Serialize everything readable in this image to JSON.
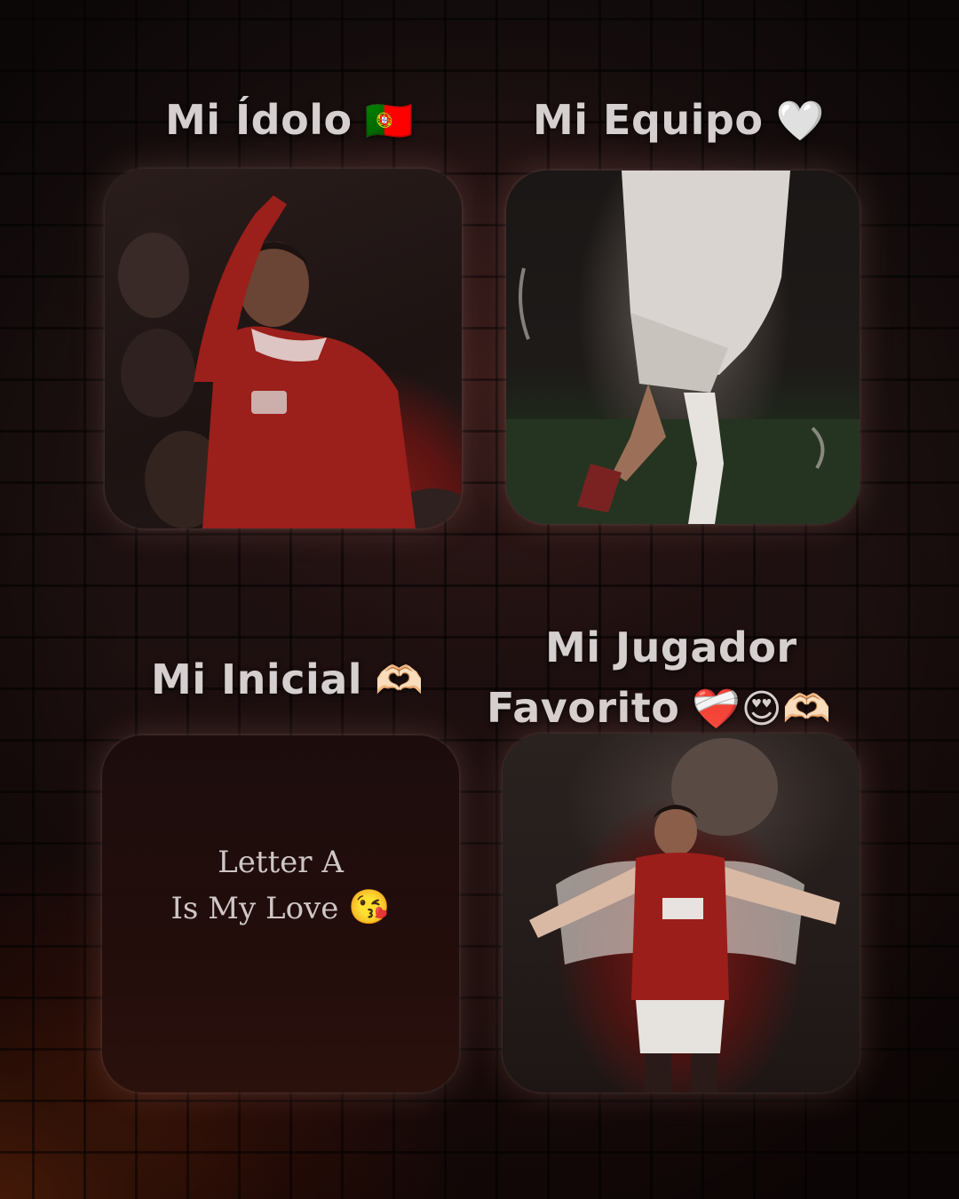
{
  "colors": {
    "background": "#140808",
    "glow": "#be4614",
    "label_text": "#d6cfcf"
  },
  "cards": {
    "idolo": {
      "title": "Mi Ídolo",
      "emoji": "🇵🇹",
      "image": "player-red-kit"
    },
    "equipo": {
      "title": "Mi Equipo",
      "emoji": "🤍",
      "image": "player-white-kit"
    },
    "inicial": {
      "title": "Mi Inicial",
      "emoji": "🫶🏻",
      "line1": "Letter A",
      "line2": "Is My Love",
      "line2_emoji": "😘"
    },
    "favorito": {
      "title_line1": "Mi Jugador",
      "title_line2": "Favorito",
      "emoji": "❤️‍🩹😍🫶🏻",
      "image": "player-arms-spread"
    }
  }
}
